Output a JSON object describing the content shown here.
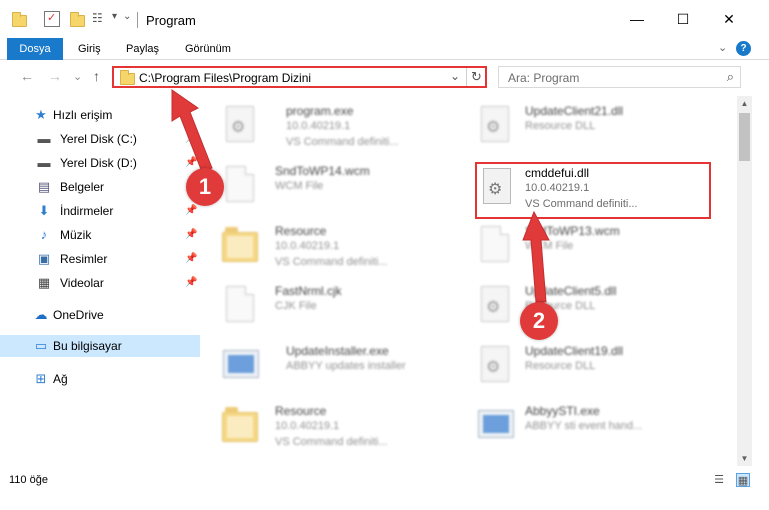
{
  "window": {
    "title": "Program",
    "minimize": "—",
    "maximize": "☐",
    "close": "✕"
  },
  "ribbon": {
    "tabs": [
      {
        "label": "Dosya"
      },
      {
        "label": "Giriş"
      },
      {
        "label": "Paylaş"
      },
      {
        "label": "Görünüm"
      }
    ],
    "expand": "⌄",
    "help": "?"
  },
  "nav": {
    "back": "←",
    "forward": "→",
    "recent": "⌄",
    "up": "↑"
  },
  "address": {
    "path": "C:\\Program Files\\Program Dizini",
    "dropdown": "⌄",
    "refresh": "↻"
  },
  "search": {
    "placeholder": "Ara: Program",
    "icon": "⌕"
  },
  "sidebar": {
    "items": [
      {
        "label": "Hızlı erişim",
        "icon": "★"
      },
      {
        "label": "Yerel Disk (C:)",
        "icon": "▬",
        "pin": "📌"
      },
      {
        "label": "Yerel Disk (D:)",
        "icon": "▬",
        "pin": "📌"
      },
      {
        "label": "Belgeler",
        "icon": "▤",
        "pin": "📌"
      },
      {
        "label": "İndirmeler",
        "icon": "⬇",
        "pin": "📌"
      },
      {
        "label": "Müzik",
        "icon": "♪",
        "pin": "📌"
      },
      {
        "label": "Resimler",
        "icon": "▣",
        "pin": "📌"
      },
      {
        "label": "Videolar",
        "icon": "▦",
        "pin": "📌"
      },
      {
        "label": "OneDrive",
        "icon": "☁"
      },
      {
        "label": "Bu bilgisayar",
        "icon": "▭"
      },
      {
        "label": "Ağ",
        "icon": "⊞"
      }
    ]
  },
  "files": [
    {
      "name": "program.exe",
      "l2": "10.0.40219.1",
      "l3": "VS Command definiti..."
    },
    {
      "name": "UpdateClient21.dll",
      "l2": "Resource DLL",
      "l3": ""
    },
    {
      "name": "SndToWP14.wcm",
      "l2": "WCM File",
      "l3": ""
    },
    {
      "name": "cmddefui.dll",
      "l2": "10.0.40219.1",
      "l3": "VS Command definiti..."
    },
    {
      "name": "Resource",
      "l2": "10.0.40219.1",
      "l3": "VS Command definiti..."
    },
    {
      "name": "SndToWP13.wcm",
      "l2": "WCM File",
      "l3": ""
    },
    {
      "name": "FastNrml.cjk",
      "l2": "CJK File",
      "l3": ""
    },
    {
      "name": "UpdateClient5.dll",
      "l2": "Resource DLL",
      "l3": ""
    },
    {
      "name": "UpdateInstaller.exe",
      "l2": "ABBYY updates installer",
      "l3": ""
    },
    {
      "name": "UpdateClient19.dll",
      "l2": "Resource DLL",
      "l3": ""
    },
    {
      "name": "Resource",
      "l2": "10.0.40219.1",
      "l3": "VS Command definiti..."
    },
    {
      "name": "AbbyySTI.exe",
      "l2": "ABBYY sti event hand...",
      "l3": ""
    }
  ],
  "status": {
    "count": "110 öğe"
  },
  "annotations": {
    "badge1": "1",
    "badge2": "2",
    "color": "#e03a3a"
  }
}
